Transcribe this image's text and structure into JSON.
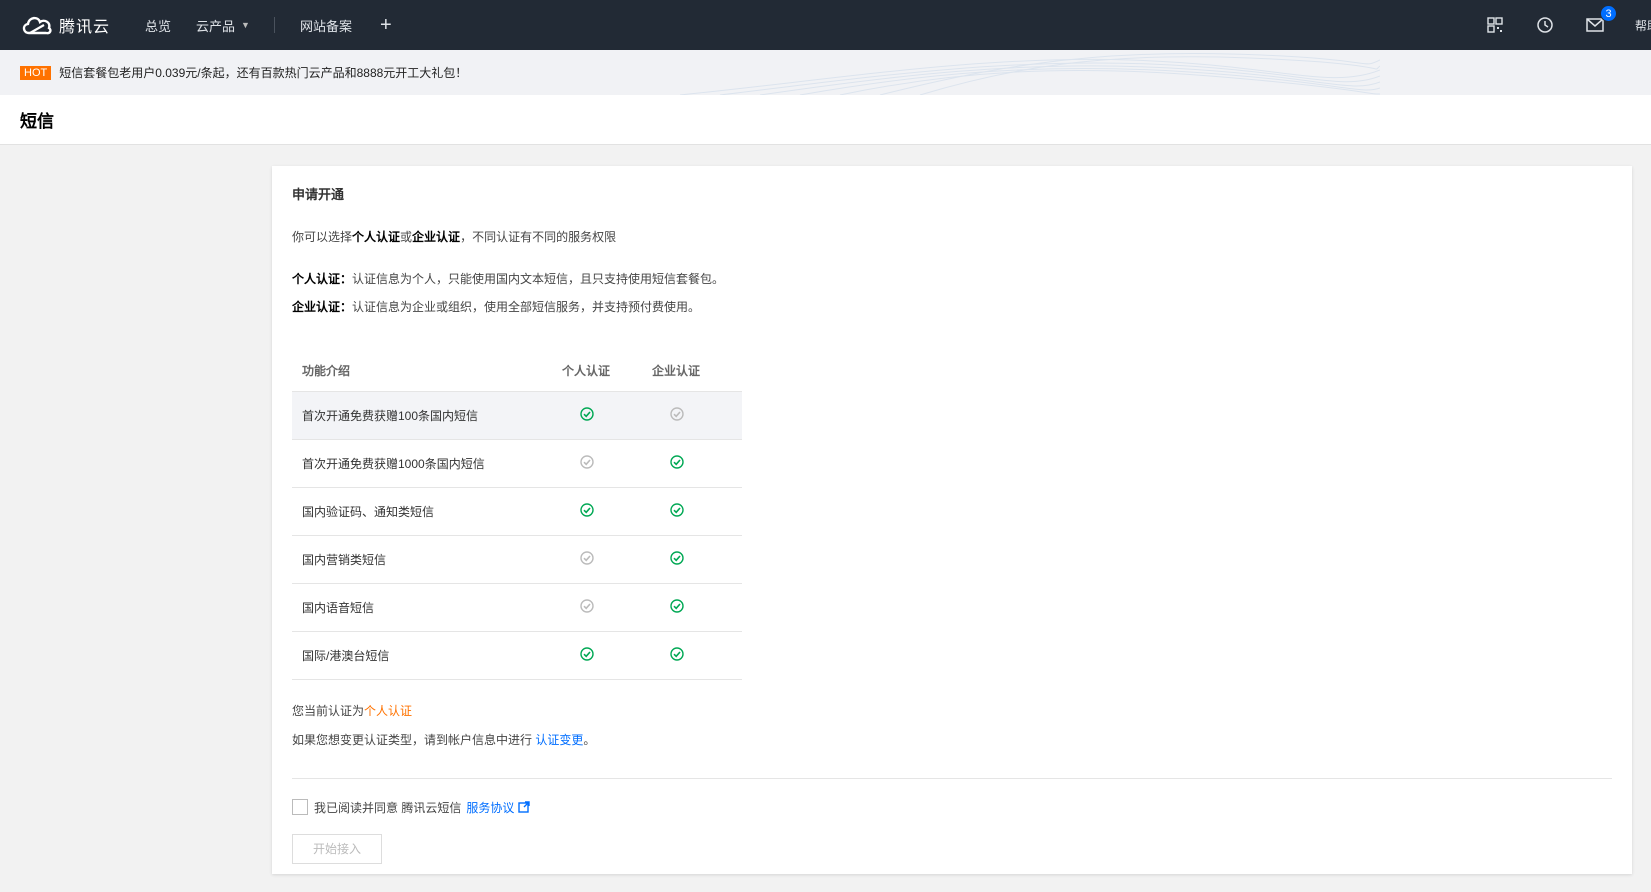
{
  "nav": {
    "brand": "腾讯云",
    "items": [
      "总览",
      "云产品",
      "网站备案"
    ],
    "badge_count": "3",
    "help_label": "帮助"
  },
  "announce": {
    "hot_label": "HOT",
    "text": "短信套餐包老用户0.039元/条起，还有百款热门云产品和8888元开工大礼包！"
  },
  "page": {
    "title": "短信"
  },
  "card": {
    "title": "申请开通",
    "intro_prefix": "你可以选择",
    "intro_personal": "个人认证",
    "intro_or": "或",
    "intro_enterprise": "企业认证",
    "intro_suffix": "，不同认证有不同的服务权限",
    "personal_label": "个人认证：",
    "personal_desc": "认证信息为个人，只能使用国内文本短信，且只支持使用短信套餐包。",
    "enterprise_label": "企业认证：",
    "enterprise_desc": "认证信息为企业或组织，使用全部短信服务，并支持预付费使用。",
    "table": {
      "headers": [
        "功能介绍",
        "个人认证",
        "企业认证"
      ],
      "rows": [
        {
          "feature": "首次开通免费获赠100条国内短信",
          "personal": true,
          "enterprise": false
        },
        {
          "feature": "首次开通免费获赠1000条国内短信",
          "personal": false,
          "enterprise": true
        },
        {
          "feature": "国内验证码、通知类短信",
          "personal": true,
          "enterprise": true
        },
        {
          "feature": "国内营销类短信",
          "personal": false,
          "enterprise": true
        },
        {
          "feature": "国内语音短信",
          "personal": false,
          "enterprise": true
        },
        {
          "feature": "国际/港澳台短信",
          "personal": true,
          "enterprise": true
        }
      ]
    },
    "current_prefix": "您当前认证为",
    "current_value": "个人认证",
    "change_prefix": "如果您想变更认证类型，请到帐户信息中进行",
    "change_link": "认证变更",
    "change_suffix": "。",
    "agree_text": "我已阅读并同意 腾讯云短信",
    "agree_link": "服务协议",
    "start_button": "开始接入"
  },
  "colors": {
    "accent": "#006eff",
    "hot": "#ff7200",
    "check_green": "#00a854",
    "check_gray": "#bbbbbb",
    "nav_bg": "#222a35"
  },
  "icons": {
    "logo": "cloud-icon",
    "qr": "qrcode-icon",
    "clock": "clock-icon",
    "mail": "mail-icon",
    "external": "external-link-icon"
  }
}
